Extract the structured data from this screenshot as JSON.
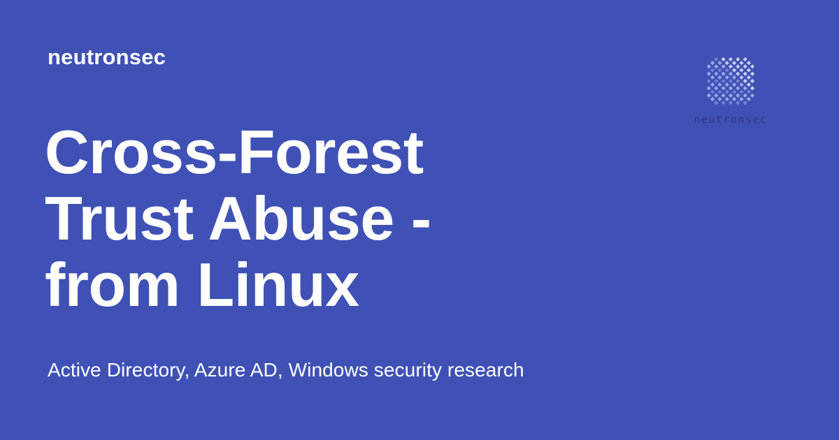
{
  "header": {
    "site_name": "neutronsec"
  },
  "article": {
    "title_lines": [
      "Cross-Forest",
      "Trust Abuse -",
      "from Linux"
    ],
    "tagline": "Active Directory, Azure AD, Windows security research"
  },
  "logo": {
    "icon": "diamond-grid-logo-icon",
    "wordmark": "neutronsec"
  },
  "colors": {
    "background": "#3f51b5",
    "text": "#ffffff",
    "logo_light": "#c5cdf0",
    "logo_mid": "#9aa8e6",
    "logo_dark": "#7181d6",
    "logo_wordmark": "#2e3d86"
  }
}
